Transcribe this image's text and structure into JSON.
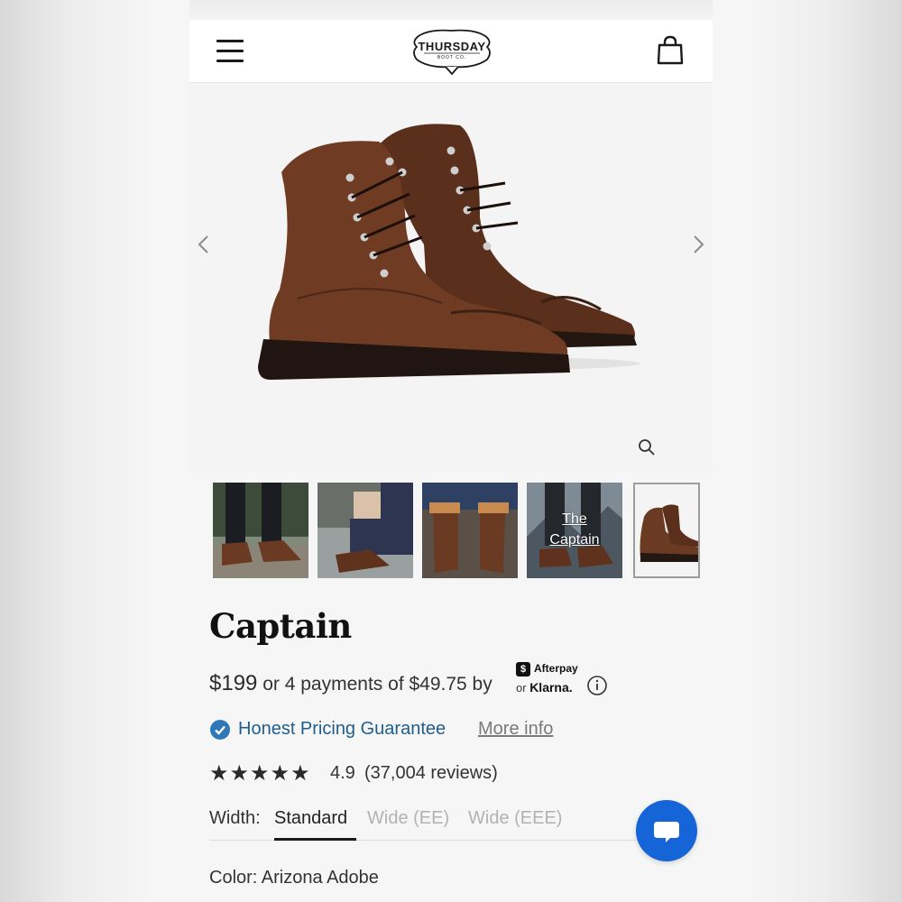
{
  "header": {
    "logo_word": "THURSDAY",
    "logo_sub": "BOOT CO.",
    "menu_icon": "hamburger-menu-icon",
    "cart_icon": "shopping-bag-icon"
  },
  "gallery": {
    "prev_icon": "chevron-left-icon",
    "next_icon": "chevron-right-icon",
    "zoom_icon": "magnifier-icon",
    "thumbnails": [
      {
        "caption": ""
      },
      {
        "caption": ""
      },
      {
        "caption": ""
      },
      {
        "caption_line1": "The",
        "caption_line2": "Captain"
      },
      {
        "caption": "",
        "selected": true
      }
    ]
  },
  "product": {
    "title": "Captain",
    "price": "$199",
    "installments": "or 4 payments of $49.75 by",
    "afterpay_label": "Afterpay",
    "klarna_prefix": "or",
    "klarna_label": "Klarna.",
    "guarantee_label": "Honest Pricing Guarantee",
    "more_info_label": "More info",
    "rating_stars": "★★★★★",
    "rating_value": "4.9",
    "reviews": "(37,004 reviews)",
    "width_label": "Width:",
    "width_options": [
      "Standard",
      "Wide (EE)",
      "Wide (EEE)"
    ],
    "width_selected": "Standard",
    "color_label": "Color: Arizona Adobe"
  },
  "colors": {
    "accent_blue": "#1f5e8c",
    "chat_button": "#1565d8",
    "boot_leather": "#6b3a22"
  }
}
